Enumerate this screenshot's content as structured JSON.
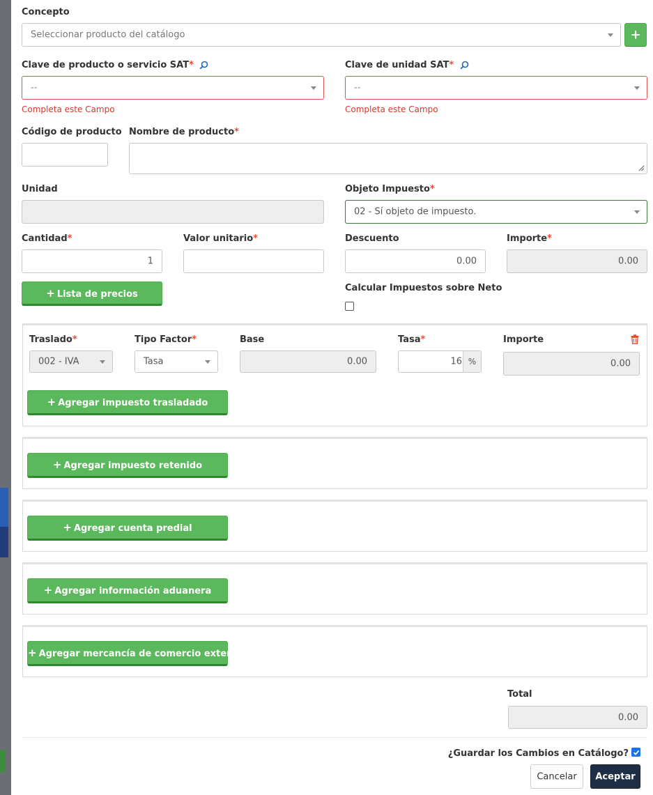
{
  "form": {
    "concepto": {
      "label": "Concepto",
      "placeholder": "Seleccionar producto del catálogo"
    },
    "clave_producto": {
      "label": "Clave de producto o servicio SAT",
      "required_mark": "*",
      "value": "--",
      "error": "Completa este Campo"
    },
    "clave_unidad": {
      "label": "Clave de unidad SAT",
      "required_mark": "*",
      "value": "--",
      "error": "Completa este Campo"
    },
    "codigo_producto": {
      "label": "Código de producto",
      "value": ""
    },
    "nombre_producto": {
      "label": "Nombre de producto",
      "required_mark": "*",
      "value": ""
    },
    "unidad": {
      "label": "Unidad",
      "value": ""
    },
    "objeto_impuesto": {
      "label": "Objeto Impuesto",
      "required_mark": "*",
      "value": "02 - Sí objeto de impuesto."
    },
    "cantidad": {
      "label": "Cantidad",
      "required_mark": "*",
      "value": "1"
    },
    "valor_unitario": {
      "label": "Valor unitario",
      "required_mark": "*",
      "value": ""
    },
    "descuento": {
      "label": "Descuento",
      "value": "0.00"
    },
    "importe": {
      "label": "Importe",
      "required_mark": "*",
      "value": "0.00"
    },
    "lista_precios_button": "Lista de precios",
    "calcular_neto": {
      "label": "Calcular Impuestos sobre Neto",
      "checked": false
    }
  },
  "tax_transferred": {
    "headers": {
      "traslado": "Traslado",
      "tipo_factor": "Tipo Factor",
      "base": "Base",
      "tasa": "Tasa",
      "importe": "Importe",
      "required_mark": "*"
    },
    "row": {
      "traslado": "002 - IVA",
      "tipo_factor": "Tasa",
      "base": "0.00",
      "tasa": "16",
      "tasa_unit": "%",
      "importe": "0.00"
    },
    "add_button": "Agregar impuesto trasladado"
  },
  "sections": {
    "retenido_button": "Agregar impuesto retenido",
    "predial_button": "Agregar cuenta predial",
    "aduanera_button": "Agregar información aduanera",
    "comercio_button": "Agregar mercancía de comercio exterior"
  },
  "total": {
    "label": "Total",
    "value": "0.00"
  },
  "footer": {
    "guardar_label": "¿Guardar los Cambios en Catálogo?",
    "guardar_checked": true,
    "cancel": "Cancelar",
    "accept": "Aceptar"
  },
  "colors": {
    "green": "#5cb85c",
    "error_red": "#d9382c",
    "required_red": "#e74c3c",
    "dark_button": "#1e2f45"
  },
  "icons": {
    "plus": "+",
    "search": "magnifier",
    "trash": "trash-can",
    "caret": "caret-down",
    "check": "checkmark"
  }
}
